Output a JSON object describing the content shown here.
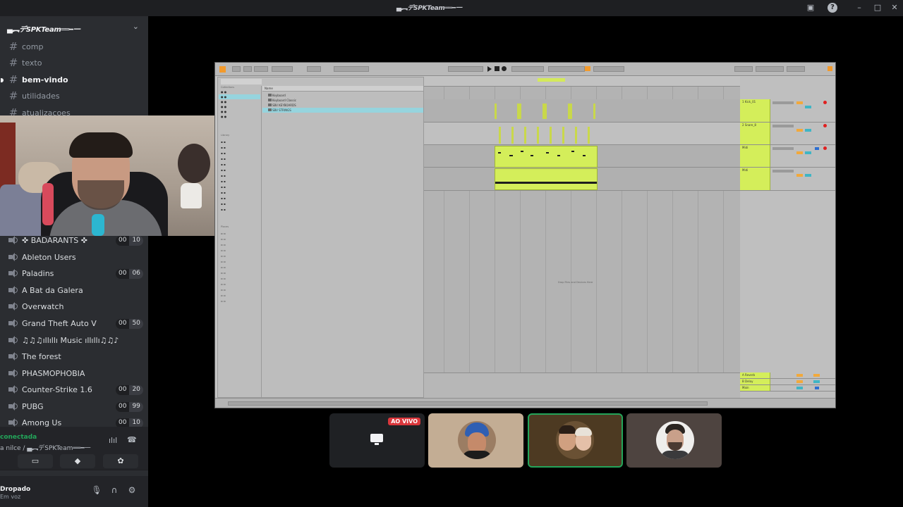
{
  "titlebar": {
    "title": "▄︻デSPKTeam══━一",
    "inbox_icon": "inbox-icon",
    "help_icon": "?",
    "minimize": "–",
    "maximize": "□",
    "close": "✕"
  },
  "server": {
    "name": "▄︻デSPKTeam══━一",
    "chevron": "⌄"
  },
  "text_channels": [
    {
      "label": "comp"
    },
    {
      "label": "texto"
    },
    {
      "label": "bem-vindo"
    },
    {
      "label": "utilidades"
    },
    {
      "label": "atualizacoes"
    }
  ],
  "voice_channels": [
    {
      "label": "✜ BADARANTS ✜",
      "count_a": "00",
      "count_b": "10"
    },
    {
      "label": "Ableton Users"
    },
    {
      "label": "Paladins",
      "count_a": "00",
      "count_b": "06"
    },
    {
      "label": "A Bat da Galera"
    },
    {
      "label": "Overwatch"
    },
    {
      "label": "Grand Theft Auto V",
      "count_a": "00",
      "count_b": "50"
    },
    {
      "label": "♫♫♫ıllıllı Music ıllıllı♫♫♪"
    },
    {
      "label": "The forest"
    },
    {
      "label": "PHASMOPHOBIA"
    },
    {
      "label": "Counter-Strike 1.6",
      "count_a": "00",
      "count_b": "20"
    },
    {
      "label": "PUBG",
      "count_a": "00",
      "count_b": "99"
    },
    {
      "label": "Among Us",
      "count_a": "00",
      "count_b": "10"
    }
  ],
  "voice_panel": {
    "status": "conectada",
    "channel": "a nilce / ▄︻デSPKTeam══━一"
  },
  "user_panel": {
    "name": "Dropado",
    "status": "Em voz"
  },
  "ableton": {
    "browser_list_header": "Name",
    "categories": [
      "Collections",
      "Library",
      "Places"
    ],
    "list_items": [
      "Keyboard",
      "Keyboard Classic",
      "SBV KEYBOARDS",
      "SBV STRINGS"
    ],
    "drop_hint": "Drop Files and Devices Here",
    "mixer_tracks": [
      "1 Kick_01",
      "2 Snare_8",
      "Midi",
      "Midi"
    ],
    "return_tracks": [
      "A Reverb",
      "B Delay",
      "Main"
    ]
  },
  "tiles": {
    "live_badge": "AO VIVO"
  },
  "colors": {
    "clip_green": "#d4ee5a",
    "discord_green": "#23a55a",
    "live_red": "#da373c"
  }
}
